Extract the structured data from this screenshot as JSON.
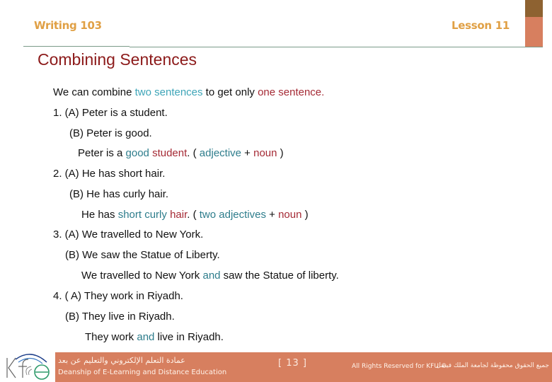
{
  "header": {
    "course": "Writing 103",
    "lesson": "Lesson 11",
    "accent_colors": {
      "dark": "#8e6231",
      "light": "#d77f5f"
    }
  },
  "title": "Combining Sentences",
  "intro": {
    "p1": "We can combine ",
    "h1": "two sentences",
    "p2": " to get only ",
    "h2": "one sentence."
  },
  "examples": [
    {
      "a": "1.  (A) Peter is a student.",
      "b": "(B) Peter is good.",
      "result": {
        "p1": "Peter is a ",
        "adj": "good",
        "sp": " ",
        "noun": "student",
        "p2": ". ( ",
        "t1": "adjective",
        "plus": " + ",
        "t2": "noun",
        "p3": " )"
      }
    },
    {
      "a": "2.  (A) He has short hair.",
      "b": "(B) He has curly hair.",
      "result": {
        "p1": "He has ",
        "adj": "short curly",
        "sp": " ",
        "noun": "hair",
        "p2": ". ( ",
        "t1": "two adjectives",
        "plus": " + ",
        "t2": "noun",
        "p3": " )"
      }
    },
    {
      "a": "3. (A) We travelled to New York.",
      "b": "(B) We saw the Statue of Liberty.",
      "result": {
        "p1": "We travelled to New York ",
        "conj": "and",
        "p2": " saw the Statue of liberty."
      }
    },
    {
      "a": "4. ( A) They work in Riyadh.",
      "b": "(B) They live in Riyadh.",
      "result": {
        "p1": "They work ",
        "conj": "and",
        "p2": " live in Riyadh."
      }
    }
  ],
  "footer": {
    "dean_ar": "عمادة التعلم الإلكتروني والتعليم عن بعد",
    "dean_en": "Deanship of E-Learning and Distance Education",
    "page": "[  13  ]",
    "rights": "All Rights Reserved for KFU ©",
    "rights_ar": "جميع الحقوق محفوظة لجامعة الملك فيصل",
    "bar_color": "#d77f5f"
  }
}
